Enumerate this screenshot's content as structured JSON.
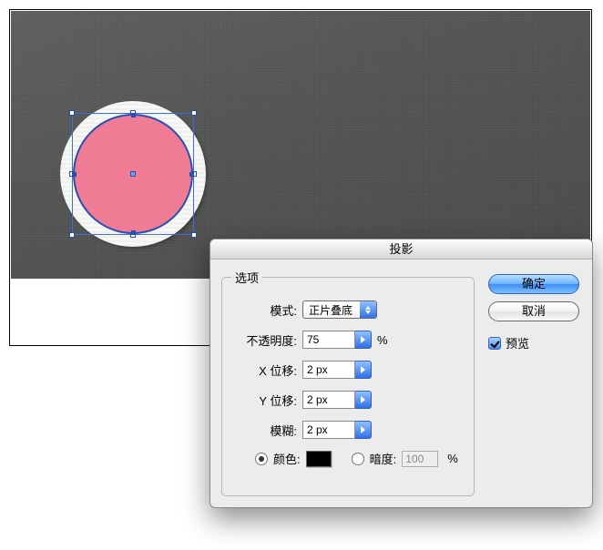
{
  "dialog": {
    "title": "投影",
    "options_legend": "选项",
    "mode_label": "模式:",
    "mode_value": "正片叠底",
    "opacity_label": "不透明度:",
    "opacity_value": "75",
    "opacity_unit": "%",
    "xoffset_label": "X 位移:",
    "xoffset_value": "2 px",
    "yoffset_label": "Y 位移:",
    "yoffset_value": "2 px",
    "blur_label": "模糊:",
    "blur_value": "2 px",
    "color_label": "颜色:",
    "color_swatch": "#000000",
    "darkness_label": "暗度:",
    "darkness_value": "100",
    "darkness_unit": "%",
    "ok_label": "确定",
    "cancel_label": "取消",
    "preview_label": "预览"
  }
}
